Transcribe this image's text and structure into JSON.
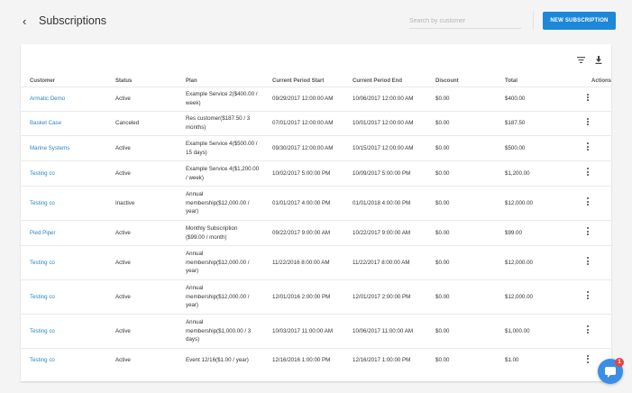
{
  "header": {
    "back_icon": "chevron-left-icon",
    "title": "Subscriptions",
    "search_placeholder": "Search by customer",
    "new_button_label": "NEW SUBSCRIPTION",
    "accent": "#1e88d8"
  },
  "toolbar": {
    "filter_icon": "filter-icon",
    "download_icon": "download-icon"
  },
  "table": {
    "columns": [
      "Customer",
      "Status",
      "Plan",
      "Current Period Start",
      "Current Period End",
      "Discount",
      "Total",
      "Actions"
    ],
    "rows": [
      {
        "customer": "Armatic Demo",
        "status": "Active",
        "plan": [
          "Example Service 2($400.00 /",
          "week)"
        ],
        "start": "09/29/2017 12:00:00 AM",
        "end": "10/06/2017 12:00:00 AM",
        "discount": "$0.00",
        "total": "$400.00"
      },
      {
        "customer": "Basket Case",
        "status": "Canceled",
        "plan": [
          "Res customer($187.50 / 3",
          "months)"
        ],
        "start": "07/01/2017 12:00:00 AM",
        "end": "10/01/2017 12:00:00 AM",
        "discount": "$0.00",
        "total": "$187.50"
      },
      {
        "customer": "Marine Systems",
        "status": "Active",
        "plan": [
          "Example Service 4($500.00 /",
          "15 days)"
        ],
        "start": "09/30/2017 12:00:00 AM",
        "end": "10/15/2017 12:00:00 AM",
        "discount": "$0.00",
        "total": "$500.00"
      },
      {
        "customer": "Testing co",
        "status": "Active",
        "plan": [
          "Example Service 4($1,200.00",
          "/ week)"
        ],
        "start": "10/02/2017 5:00:00 PM",
        "end": "10/09/2017 5:00:00 PM",
        "discount": "$0.00",
        "total": "$1,200.00"
      },
      {
        "customer": "Testing co",
        "status": "Inactive",
        "plan": [
          "Annual",
          "membership($12,000.00 /",
          "year)"
        ],
        "start": "01/01/2017 4:00:00 PM",
        "end": "01/01/2018 4:00:00 PM",
        "discount": "$0.00",
        "total": "$12,000.00"
      },
      {
        "customer": "Pied Piper",
        "status": "Active",
        "plan": [
          "Monthly Subscription",
          "($99.00 / month)"
        ],
        "start": "09/22/2017 9:00:00 AM",
        "end": "10/22/2017 9:00:00 AM",
        "discount": "$0.00",
        "total": "$99.00"
      },
      {
        "customer": "Testing co",
        "status": "Active",
        "plan": [
          "Annual",
          "membership($12,000.00 /",
          "year)"
        ],
        "start": "11/22/2016 8:00:00 AM",
        "end": "11/22/2017 8:00:00 AM",
        "discount": "$0.00",
        "total": "$12,000.00"
      },
      {
        "customer": "Testing co",
        "status": "Active",
        "plan": [
          "Annual",
          "membership($12,000.00 /",
          "year)"
        ],
        "start": "12/01/2016 2:00:00 PM",
        "end": "12/01/2017 2:00:00 PM",
        "discount": "$0.00",
        "total": "$12,000.00"
      },
      {
        "customer": "Testing co",
        "status": "Active",
        "plan": [
          "Annual",
          "membership($1,000.00 / 3",
          "days)"
        ],
        "start": "10/03/2017 11:00:00 AM",
        "end": "10/06/2017 11:00:00 AM",
        "discount": "$0.00",
        "total": "$1,000.00"
      },
      {
        "customer": "Testing co",
        "status": "Active",
        "plan": [
          "Event 12/16($1.00 / year)"
        ],
        "start": "12/16/2016 1:00:00 PM",
        "end": "12/16/2017 1:00:00 PM",
        "discount": "$0.00",
        "total": "$1.00"
      }
    ]
  },
  "chat": {
    "icon": "chat-bubble-icon",
    "badge_count": "1",
    "color": "#3a8ee6"
  }
}
